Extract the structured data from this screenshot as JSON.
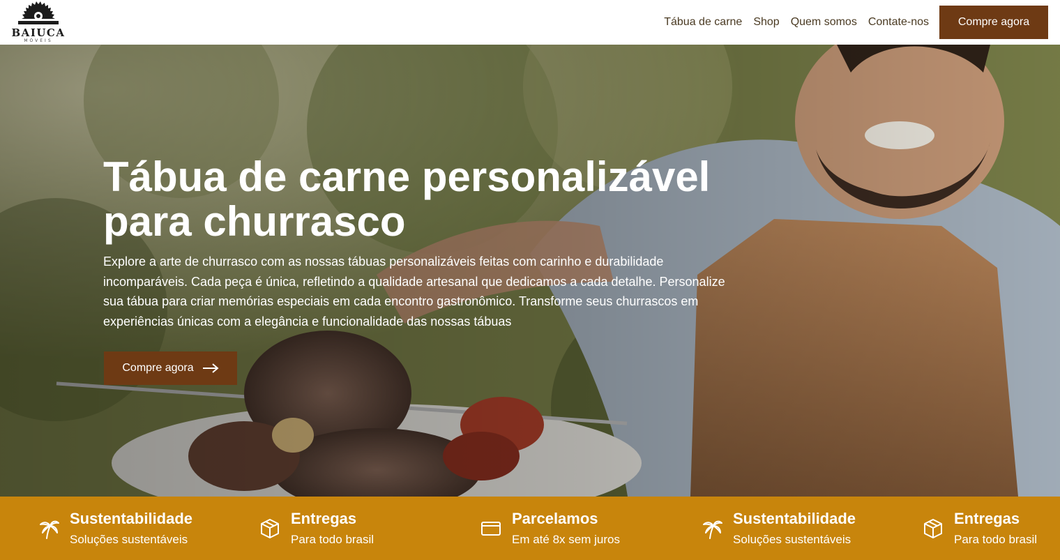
{
  "brand": {
    "name": "BAIUCA",
    "sub": "MÓVEIS"
  },
  "nav": {
    "items": [
      "Tábua de carne",
      "Shop",
      "Quem somos",
      "Contate-nos"
    ],
    "cta": "Compre agora"
  },
  "hero": {
    "title": "Tábua de carne personalizável para churrasco",
    "description": "Explore a arte de churrasco com as nossas tábuas personalizáveis feitas com carinho e durabilidade incomparáveis. Cada peça é única, refletindo a qualidade artesanal que dedicamos a cada detalhe. Personalize sua tábua para criar memórias especiais em cada encontro gastronômico. Transforme seus churrascos em experiências únicas com a elegância e funcionalidade das nossas tábuas",
    "cta": "Compre agora",
    "cta_icon": "arrow-right-icon"
  },
  "features": [
    {
      "title": "Sustentabilidade",
      "subtitle": "Soluções sustentáveis",
      "icon": "palm-tree-icon"
    },
    {
      "title": "Entregas",
      "subtitle": "Para todo brasil",
      "icon": "package-icon"
    },
    {
      "title": "Parcelamos",
      "subtitle": "Em até 8x sem juros",
      "icon": "credit-card-icon"
    },
    {
      "title": "Sustentabilidade",
      "subtitle": "Soluções sustentáveis",
      "icon": "palm-tree-icon"
    },
    {
      "title": "Entregas",
      "subtitle": "Para todo brasil",
      "icon": "package-icon"
    }
  ],
  "colors": {
    "brand_brown": "#6e3a14",
    "feature_bar": "#c8850c",
    "nav_text": "#4a3a22"
  }
}
